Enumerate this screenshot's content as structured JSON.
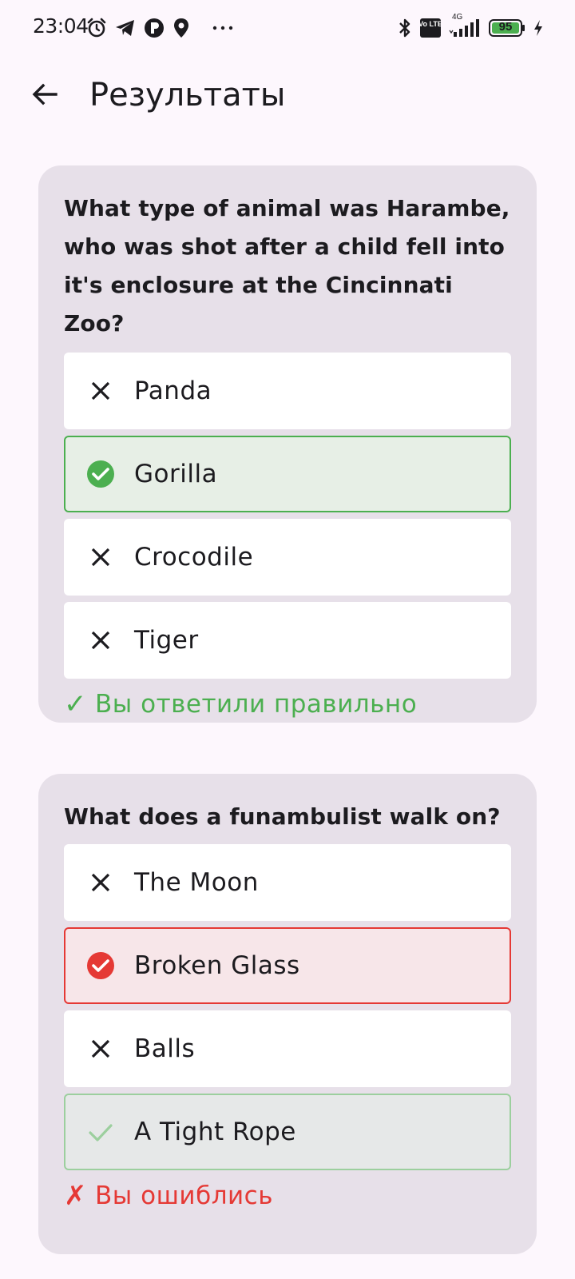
{
  "status_bar": {
    "time": "23:04",
    "left_icons": [
      "alarm-icon",
      "telegram-icon",
      "app-icon",
      "location-icon",
      "more-icon"
    ],
    "right_icons": [
      "bluetooth-icon",
      "volte-icon",
      "signal-icon",
      "battery-icon",
      "charging-icon"
    ],
    "network_label": "4G",
    "volte_label": "Vo LTE",
    "battery_level": "95",
    "battery_color": "#4caf50"
  },
  "app_bar": {
    "title": "Результаты",
    "back_icon": "arrow-back-icon"
  },
  "colors": {
    "correct": "#4caf50",
    "wrong": "#e53935",
    "card_bg": "#e7e0e9"
  },
  "questions": [
    {
      "text": "What type of animal was Harambe, who was shot after a child fell into it's enclosure at the Cincinnati Zoo?",
      "answers": [
        {
          "label": "Panda",
          "state": "incorrect"
        },
        {
          "label": "Gorilla",
          "state": "selected-correct"
        },
        {
          "label": "Crocodile",
          "state": "incorrect"
        },
        {
          "label": "Tiger",
          "state": "incorrect"
        }
      ],
      "result_mark": "✓",
      "result": "Вы ответили правильно"
    },
    {
      "text": "What does a funambulist walk on?",
      "answers": [
        {
          "label": "The Moon",
          "state": "incorrect"
        },
        {
          "label": "Broken Glass",
          "state": "selected-wrong"
        },
        {
          "label": "Balls",
          "state": "incorrect"
        },
        {
          "label": "A Tight Rope",
          "state": "correct-not-selected"
        }
      ],
      "result_mark": "✗",
      "result": "Вы ошиблись"
    }
  ]
}
